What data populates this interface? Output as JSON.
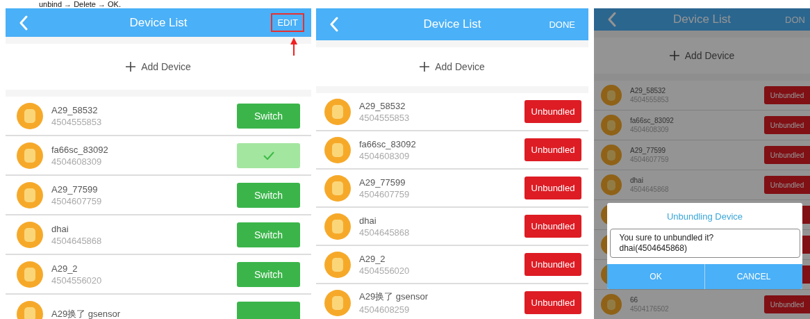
{
  "caption": "unbind → Delete → OK.",
  "screens": [
    {
      "title": "Device List",
      "action": "EDIT",
      "action_highlighted": true,
      "add_label": "Add Device",
      "dimmed": false,
      "devices": [
        {
          "kind": "switch",
          "name": "A29_58532",
          "number": "4504555853",
          "button": "Switch",
          "selected": false
        },
        {
          "kind": "switch",
          "name": "fa66sc_83092",
          "number": "4504608309",
          "selected": true
        },
        {
          "kind": "switch",
          "name": "A29_77599",
          "number": "4504607759",
          "button": "Switch",
          "selected": false
        },
        {
          "kind": "switch",
          "name": "dhai",
          "number": "4504645868",
          "button": "Switch",
          "selected": false
        },
        {
          "kind": "switch",
          "name": "A29_2",
          "number": "4504556020",
          "button": "Switch",
          "selected": false
        },
        {
          "kind": "switch",
          "name": "A29换了 gsensor",
          "selected": false
        }
      ]
    },
    {
      "title": "Device List",
      "action": "DONE",
      "action_highlighted": false,
      "add_label": "Add Device",
      "dimmed": false,
      "devices": [
        {
          "kind": "unbind",
          "name": "A29_58532",
          "number": "4504555853",
          "button": "Unbundled"
        },
        {
          "kind": "unbind",
          "name": "fa66sc_83092",
          "number": "4504608309",
          "button": "Unbundled"
        },
        {
          "kind": "unbind",
          "name": "A29_77599",
          "number": "4504607759",
          "button": "Unbundled"
        },
        {
          "kind": "unbind",
          "name": "dhai",
          "number": "4504645868",
          "button": "Unbundled"
        },
        {
          "kind": "unbind",
          "name": "A29_2",
          "number": "4504556020",
          "button": "Unbundled"
        },
        {
          "kind": "unbind",
          "name": "A29换了 gsensor",
          "number": "4504608259",
          "button": "Unbundled"
        }
      ]
    },
    {
      "title": "Device List",
      "action": "DON",
      "action_highlighted": false,
      "add_label": "Add Device",
      "dimmed": true,
      "devices": [
        {
          "kind": "unbind",
          "name": "A29_58532",
          "number": "4504555853",
          "button": "Unbundled"
        },
        {
          "kind": "unbind",
          "name": "fa66sc_83092",
          "number": "4504608309",
          "button": "Unbundled"
        },
        {
          "kind": "unbind",
          "name": "A29_77599",
          "number": "4504607759",
          "button": "Unbundled"
        },
        {
          "kind": "unbind",
          "name": "dhai",
          "number": "4504645868",
          "button": "Unbundled"
        },
        {
          "kind": "unbind"
        },
        {
          "kind": "unbind"
        },
        {
          "kind": "unbind"
        },
        {
          "kind": "unbind",
          "name": "66",
          "number": "4504176502",
          "button": "Unbundled"
        }
      ],
      "dialog": {
        "title": "Unbundling Device",
        "message": "You sure to unbundled it?",
        "detail": "dhai(4504645868)",
        "buttons": [
          "OK",
          "CANCEL"
        ]
      }
    }
  ]
}
